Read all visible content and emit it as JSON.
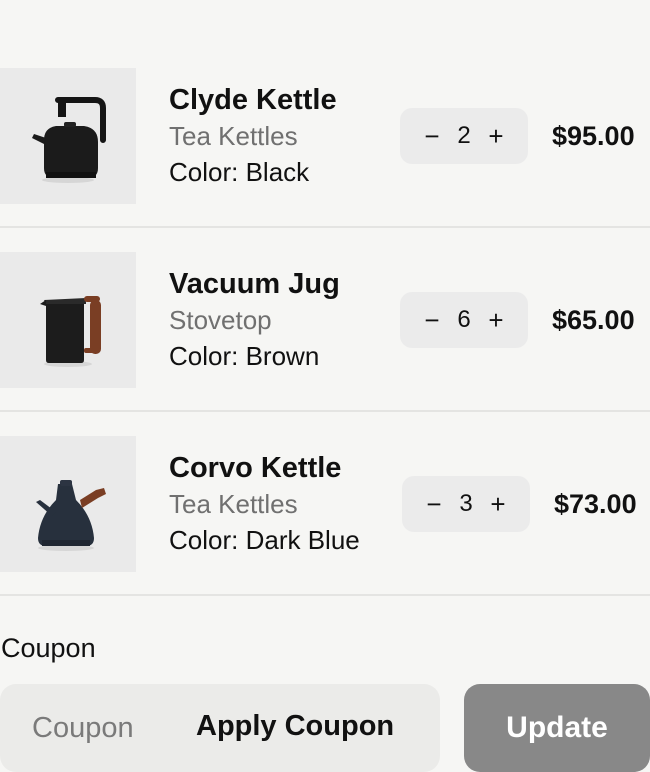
{
  "cart": {
    "items": [
      {
        "name": "Clyde Kettle",
        "category": "Tea Kettles",
        "color_text": "Color: Black",
        "quantity": "2",
        "price": "$95.00",
        "image_icon": "black-electric-kettle"
      },
      {
        "name": "Vacuum Jug",
        "category": "Stovetop",
        "color_text": "Color: Brown",
        "quantity": "6",
        "price": "$65.00",
        "image_icon": "black-jug-wood-handle"
      },
      {
        "name": "Corvo Kettle",
        "category": "Tea Kettles",
        "color_text": "Color: Dark Blue",
        "quantity": "3",
        "price": "$73.00",
        "image_icon": "dark-blue-kettle-wood-handle"
      }
    ],
    "stepper": {
      "minus_symbol": "−",
      "plus_symbol": "+"
    }
  },
  "coupon": {
    "label": "Coupon",
    "input_placeholder": "Coupon",
    "input_value": "",
    "apply_label": "Apply Coupon"
  },
  "actions": {
    "update_label": "Update"
  },
  "colors": {
    "background": "#f6f6f4",
    "thumb_bg": "#eaeaea",
    "stepper_bg": "#ebebeb",
    "update_bg": "#888888",
    "muted_text": "#707070"
  }
}
